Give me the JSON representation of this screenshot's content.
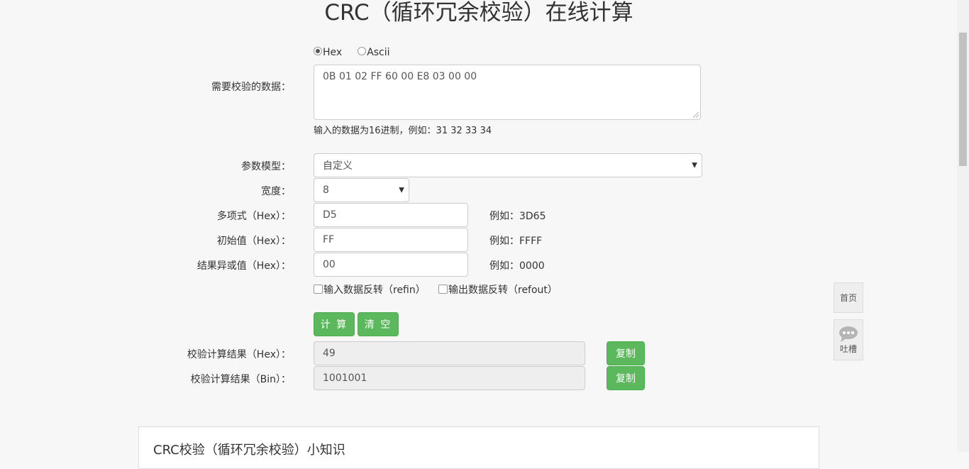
{
  "page": {
    "title": "CRC（循环冗余校验）在线计算"
  },
  "format": {
    "options": [
      "Hex",
      "Ascii"
    ],
    "selected": "Hex"
  },
  "data_input": {
    "label": "需要校验的数据：",
    "value": "0B 01 02 FF 60 00 E8 03 00 00",
    "help": "输入的数据为16进制，例如：31 32 33 34"
  },
  "model": {
    "label": "参数模型：",
    "value": "自定义"
  },
  "width": {
    "label": "宽度：",
    "value": "8"
  },
  "poly": {
    "label": "多项式（Hex）：",
    "value": "D5",
    "example": "例如：3D65"
  },
  "init": {
    "label": "初始值（Hex）：",
    "value": "FF",
    "example": "例如：FFFF"
  },
  "xorout": {
    "label": "结果异或值（Hex）：",
    "value": "00",
    "example": "例如：0000"
  },
  "refin": {
    "label": "输入数据反转（refin）",
    "checked": false
  },
  "refout": {
    "label": "输出数据反转（refout）",
    "checked": false
  },
  "buttons": {
    "calculate": "计 算",
    "clear": "清 空",
    "copy": "复制"
  },
  "result_hex": {
    "label": "校验计算结果（Hex）：",
    "value": "49"
  },
  "result_bin": {
    "label": "校验计算结果（Bin）：",
    "value": "1001001"
  },
  "side": {
    "home": "首页",
    "feedback": "吐槽"
  },
  "section": {
    "title": "CRC校验（循环冗余校验）小知识"
  }
}
